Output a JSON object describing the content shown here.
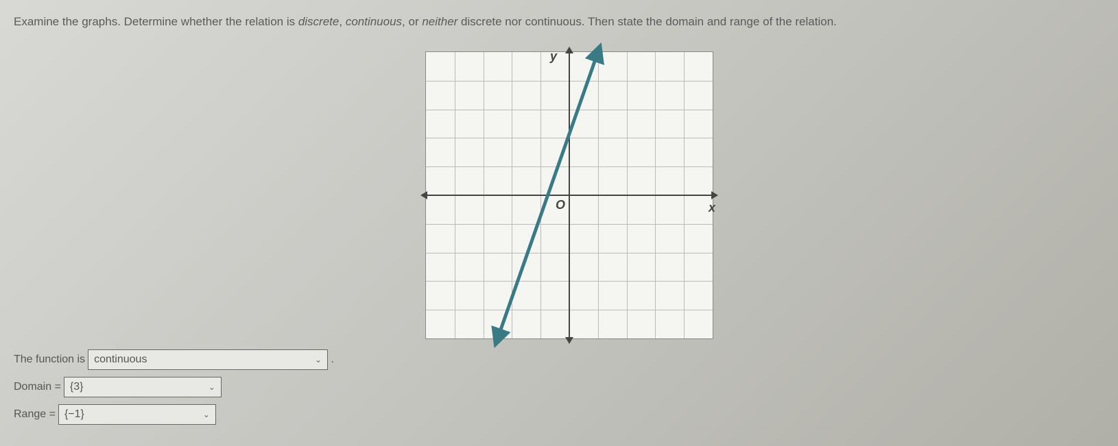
{
  "question": {
    "prefix": "Examine the graphs. Determine whether the relation is ",
    "italic1": "discrete",
    "sep1": ", ",
    "italic2": "continuous",
    "sep2": ", or ",
    "italic3": "neither",
    "suffix": " discrete nor continuous. Then state the domain and range of the relation."
  },
  "graph": {
    "label_y": "y",
    "label_x": "x",
    "label_origin": "O"
  },
  "answers": {
    "function_label": "The function is",
    "function_value": "continuous",
    "domain_label": "Domain =",
    "domain_value": "{3}",
    "range_label": "Range =",
    "range_value": "{−1}"
  },
  "chart_data": {
    "type": "line",
    "description": "A straight line on a coordinate grid with arrows at both ends indicating it extends infinitely",
    "points": [
      {
        "x": -2.5,
        "y": -5
      },
      {
        "x": 1,
        "y": 5
      }
    ],
    "slope_approx": 2.86,
    "x_range": [
      -5,
      5
    ],
    "y_range": [
      -5,
      5
    ],
    "grid": true,
    "xlabel": "x",
    "ylabel": "y",
    "line_color": "#3a7a85",
    "arrows_on_line": true
  }
}
